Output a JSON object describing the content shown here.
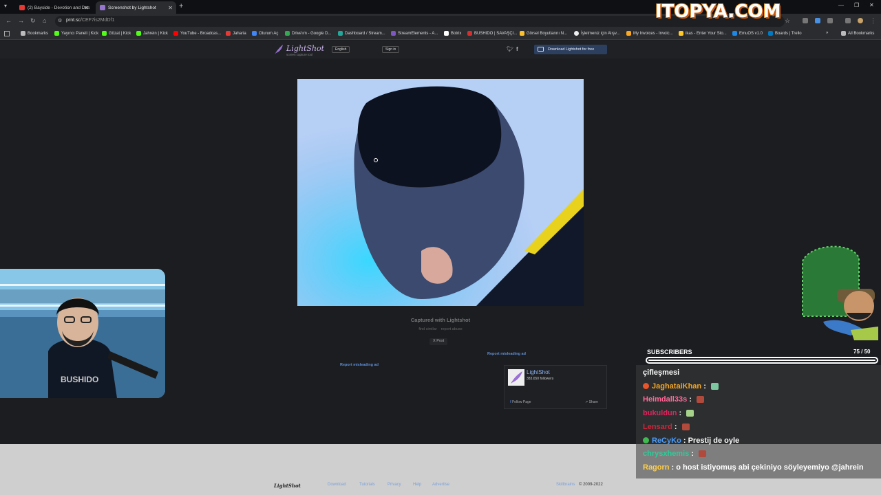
{
  "browser": {
    "tabs": [
      {
        "title": "(2) Bayside - Devotion and Des",
        "icon_color": "#e53935",
        "active": false
      },
      {
        "title": "Screenshot by Lightshot",
        "icon_color": "#9575cd",
        "active": true
      }
    ],
    "url_host": "prnt.sc",
    "url_path": "/CEF7is2MdDf1",
    "bookmarks": [
      {
        "label": "Bookmarks",
        "icon_color": "#bbbbbb"
      },
      {
        "label": "Yayıncı Paneli | Kick",
        "icon_color": "#53fc18"
      },
      {
        "label": "Gözat | Kick",
        "icon_color": "#53fc18"
      },
      {
        "label": "Jahrein | Kick",
        "icon_color": "#53fc18"
      },
      {
        "label": "YouTube - Broadcas...",
        "icon_color": "#ff0000"
      },
      {
        "label": "Jaharia",
        "icon_color": "#e53935"
      },
      {
        "label": "Oturum Aç",
        "icon_color": "#4285f4"
      },
      {
        "label": "Drive'ım - Google D...",
        "icon_color": "#34a853"
      },
      {
        "label": "Dashboard / Stream...",
        "icon_color": "#26a69a"
      },
      {
        "label": "StreamElements - A...",
        "icon_color": "#7e57c2"
      },
      {
        "label": "Botrix",
        "icon_color": "#ffffff"
      },
      {
        "label": "BUSHIDO | SAVAŞÇI...",
        "icon_color": "#d32f2f"
      },
      {
        "label": "Görsel Boyutlarını N...",
        "icon_color": "#fbc02d"
      },
      {
        "label": "İşletmeniz için Alışv...",
        "icon_color": "#eeeeee"
      },
      {
        "label": "My Invoices - Invoic...",
        "icon_color": "#f9a825"
      },
      {
        "label": "ikas - Enter Your Sto...",
        "icon_color": "#ffca28"
      },
      {
        "label": "EmuOS v1.0",
        "icon_color": "#1e88e5"
      },
      {
        "label": "Boards | Trello",
        "icon_color": "#0079bf"
      },
      {
        "label": "All Bookmarks",
        "icon_color": "#bbbbbb"
      }
    ]
  },
  "lightshot": {
    "logo_text": "LightShot",
    "tagline": "screen capture tool",
    "language": "English",
    "sign_in": "Sign in",
    "download_button": "Download Lightshot for free",
    "captured_with": "Captured with Lightshot",
    "find_similar": "find similar",
    "report_abuse": "report abuse",
    "post": "X Post",
    "report_ad_right": "Report misleading ad",
    "report_ad_left": "Report misleading ad",
    "fb_name": "LightShot",
    "fb_followers": "383,650 followers",
    "fb_follow": "Follow Page",
    "fb_share": "Share"
  },
  "footer": {
    "logo": "LightShot",
    "links": [
      "Download",
      "Tutorials",
      "Privacy",
      "Help",
      "Advertise"
    ],
    "copyright_link": "Skillbrains",
    "copyright": "© 2009-2022"
  },
  "stream": {
    "watermark": "ITOPYA.COM",
    "subscribers_label": "SUBSCRIBERS",
    "subscribers_count": "75  / 50",
    "subscribers_progress": 1.0,
    "chat": [
      {
        "user": "çifleşmesi",
        "color": "#ffffff",
        "text": "",
        "badge": "",
        "emote": ""
      },
      {
        "user": "JaghataiKhan",
        "color": "#f5a623",
        "text": "",
        "badge": "#e8552b",
        "emote": "#7cc7a0"
      },
      {
        "user": "Heimdall33s",
        "color": "#ff6b9a",
        "text": "",
        "badge": "",
        "emote": "#b04a3c"
      },
      {
        "user": "bukuldun",
        "color": "#e0245e",
        "text": "",
        "badge": "",
        "emote": "#a6d28a"
      },
      {
        "user": "Lensard",
        "color": "#d0243a",
        "text": "",
        "badge": "",
        "emote": "#b04a3c"
      },
      {
        "user": "ReCyKo",
        "color": "#4a9eff",
        "text": "Prestij de oyle",
        "badge": "#3fb950",
        "emote": ""
      },
      {
        "user": "chrysxhemis",
        "color": "#2ecc9a",
        "text": "",
        "badge": "",
        "emote": "#b04a3c"
      },
      {
        "user": "Ragorn",
        "color": "#ffcf4a",
        "text": "o host istiyomuş abi çekiniyo söyleyemiyo @jahrein",
        "badge": "",
        "emote": ""
      }
    ]
  }
}
